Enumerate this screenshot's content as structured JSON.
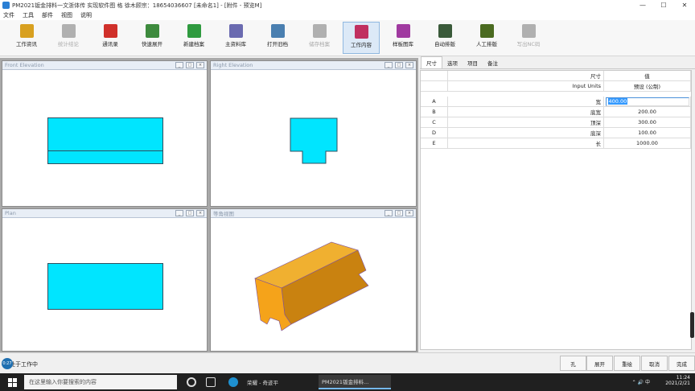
{
  "window": {
    "title": "PM2021钣金排料一文浙体传 实现软件图 格 徐木顾宗：18654036607 [未命名1] - [附件 - 预览M]",
    "controls": [
      "—",
      "☐",
      "✕"
    ]
  },
  "menu": [
    "文件",
    "工具",
    "部件",
    "视图",
    "说明"
  ],
  "toolbar": {
    "buttons": [
      {
        "label": "工作资讯",
        "icon": "info-icon",
        "color": "#d8a020",
        "disabled": false,
        "active": false
      },
      {
        "label": "统计结论",
        "icon": "dollar-icon",
        "color": "#b0b0b0",
        "disabled": true,
        "active": false
      },
      {
        "label": "通讯录",
        "icon": "contacts-icon",
        "color": "#d0302a",
        "disabled": false,
        "active": false
      },
      {
        "label": "快速展开",
        "icon": "unfold-icon",
        "color": "#3d8a3d",
        "disabled": false,
        "active": false
      },
      {
        "label": "新建档案",
        "icon": "new-file-icon",
        "color": "#2f9a3f",
        "disabled": false,
        "active": false
      },
      {
        "label": "主资料库",
        "icon": "database-icon",
        "color": "#6a6ab0",
        "disabled": false,
        "active": false
      },
      {
        "label": "打开旧档",
        "icon": "open-file-icon",
        "color": "#4a7fb0",
        "disabled": false,
        "active": false
      },
      {
        "label": "储存档案",
        "icon": "save-icon",
        "color": "#b0b0b0",
        "disabled": true,
        "active": false
      },
      {
        "label": "工作内容",
        "icon": "grid-icon",
        "color": "#c03060",
        "disabled": false,
        "active": true
      },
      {
        "label": "样板图库",
        "icon": "library-icon",
        "color": "#a03aa0",
        "disabled": false,
        "active": false
      },
      {
        "label": "自动排版",
        "icon": "auto-nest-icon",
        "color": "#3a5a3a",
        "disabled": false,
        "active": false
      },
      {
        "label": "人工排版",
        "icon": "manual-nest-icon",
        "color": "#4a6a20",
        "disabled": false,
        "active": false
      },
      {
        "label": "写出NC码",
        "icon": "nc-icon",
        "color": "#b0b0b0",
        "disabled": true,
        "active": false
      }
    ]
  },
  "panes": {
    "front": "Front Elevation",
    "right": "Right Elevation",
    "plan": "Plan",
    "iso": "等角视图",
    "pane_buttons": [
      "_",
      "□",
      "×"
    ]
  },
  "colors": {
    "part_fill": "#00e5ff",
    "iso_front": "#f5a31a",
    "iso_top": "#f0b030",
    "iso_side": "#c98210"
  },
  "props": {
    "tabs": [
      "尺寸",
      "选项",
      "项目",
      "备注"
    ],
    "header": {
      "col_name": "尺寸",
      "col_val": "值",
      "units_label": "Input Units",
      "units_value": "预设 (公制)"
    },
    "rows": [
      {
        "key": "A",
        "name": "宽",
        "value": "400.00"
      },
      {
        "key": "B",
        "name": "底宽",
        "value": "200.00"
      },
      {
        "key": "C",
        "name": "顶深",
        "value": "300.00"
      },
      {
        "key": "D",
        "name": "底深",
        "value": "100.00"
      },
      {
        "key": "E",
        "name": "长",
        "value": "1000.00"
      }
    ]
  },
  "status": {
    "text": "处于工作中",
    "badge": "0:27",
    "actions": [
      "孔",
      "展开",
      "重绘",
      "取消",
      "完成"
    ]
  },
  "taskbar": {
    "search_placeholder": "在这里输入你要搜索的内容",
    "apps": [
      "荣耀 - 奇迹平",
      "PM2021钣金排料..."
    ],
    "tray_icons": "⌃ 🔊 中",
    "time": "11:24",
    "date": "2021/2/21"
  }
}
